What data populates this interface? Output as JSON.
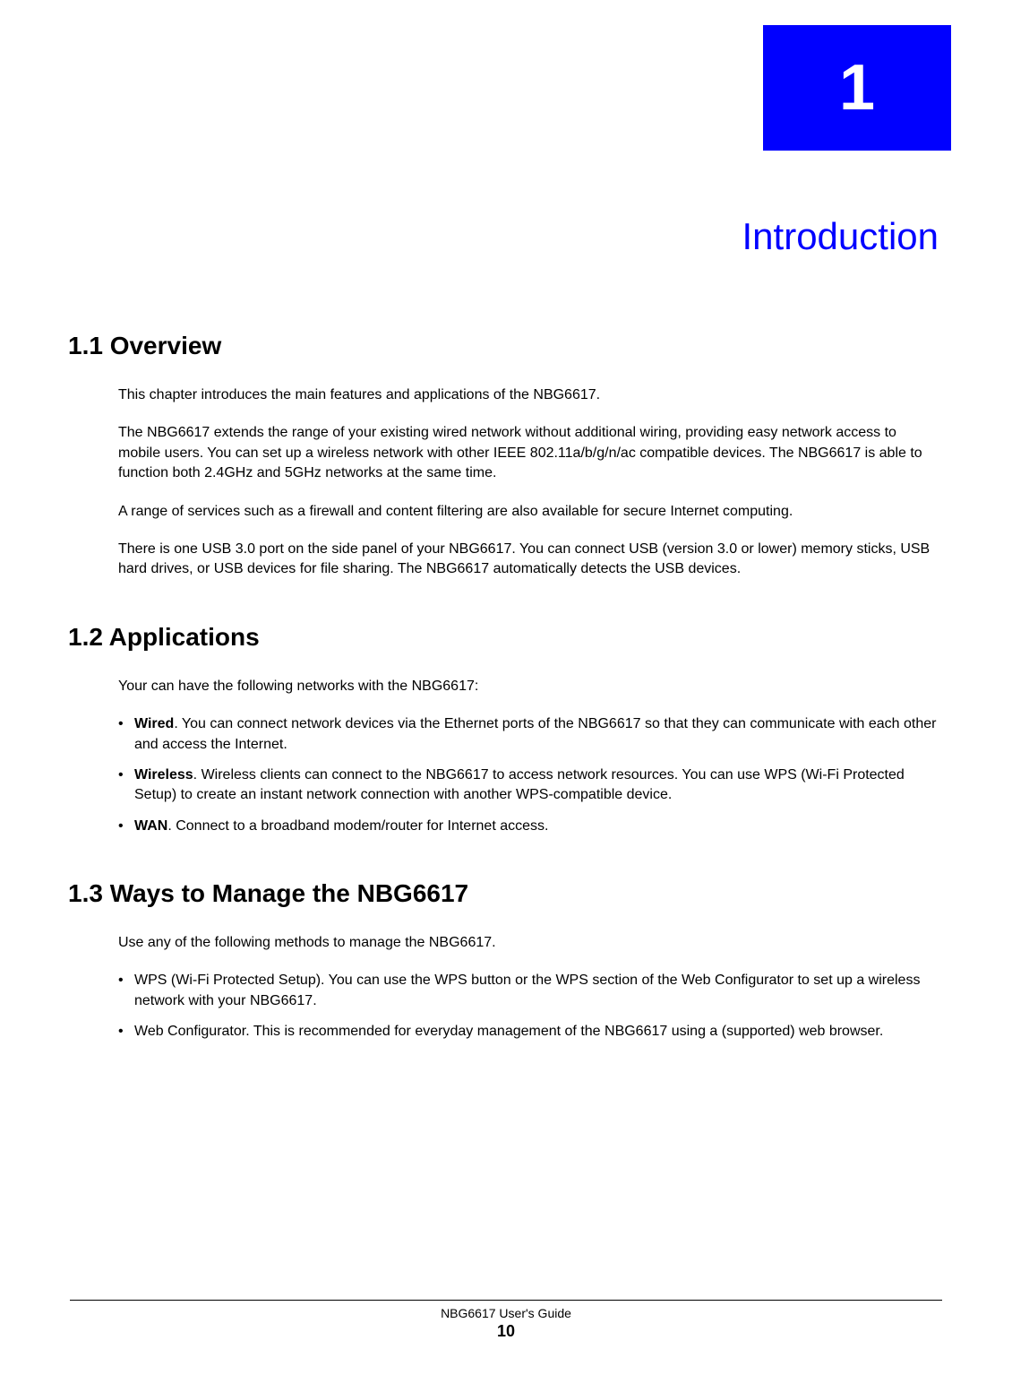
{
  "chapter": {
    "number": "1",
    "title": "Introduction"
  },
  "sections": {
    "overview": {
      "heading": "1.1  Overview",
      "p1": "This chapter introduces the main features and applications of the NBG6617.",
      "p2": "The NBG6617 extends the range of your existing wired network without additional wiring, providing easy network access to mobile users. You can set up a wireless network with other IEEE 802.11a/b/g/n/ac compatible devices. The NBG6617 is able to function both 2.4GHz and 5GHz networks at the same time.",
      "p3": "A range of services such as a firewall and content filtering are also available for secure Internet computing.",
      "p4": "There is one USB 3.0 port on the side panel of your NBG6617. You can connect USB (version 3.0 or lower) memory sticks, USB hard drives, or USB devices for file sharing. The NBG6617 automatically detects the USB devices."
    },
    "applications": {
      "heading": "1.2  Applications",
      "p1": "Your can have the following networks with the NBG6617:",
      "bullets": {
        "wired_label": "Wired",
        "wired_text": ". You can connect network devices via the Ethernet ports of the NBG6617 so that they can communicate with each other and access the Internet.",
        "wireless_label": "Wireless",
        "wireless_text": ". Wireless clients can connect to the NBG6617 to access network resources. You can use WPS (Wi-Fi Protected Setup) to create an instant network connection with another WPS-compatible device.",
        "wan_label": "WAN",
        "wan_text": ". Connect to a broadband modem/router for Internet access."
      }
    },
    "manage": {
      "heading": "1.3  Ways to Manage the NBG6617",
      "p1": "Use any of the following methods to manage the NBG6617.",
      "bullets": {
        "b1": "WPS (Wi-Fi Protected Setup). You can use the WPS button or the WPS section of the Web Configurator to set up a wireless network with your NBG6617.",
        "b2": "Web Configurator. This is recommended for everyday management of the NBG6617 using a (supported) web browser."
      }
    }
  },
  "footer": {
    "guide": "NBG6617 User's Guide",
    "page": "10"
  }
}
